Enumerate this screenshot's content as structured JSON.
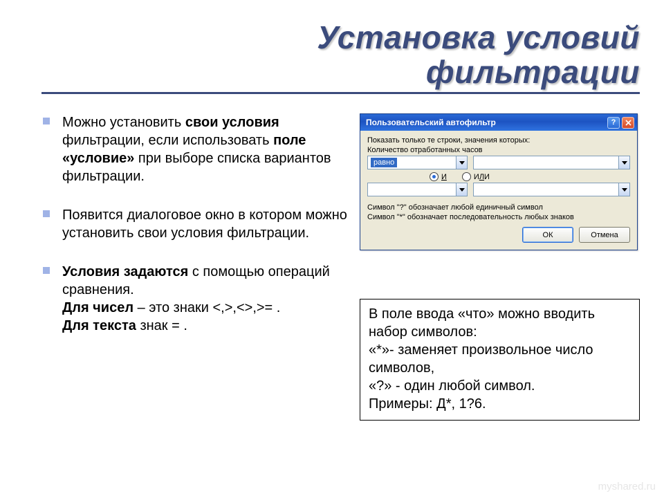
{
  "title_line1": "Установка условий",
  "title_line2": "фильтрации",
  "bullets": {
    "b1a": "Можно установить ",
    "b1b": "свои условия",
    "b1c": " фильтрации, если использовать ",
    "b1d": "поле «условие»",
    "b1e": " при выборе списка вариантов фильтрации.",
    "b2": "Появится диалоговое окно в котором можно установить свои условия фильтрации.",
    "b3a": "Условия задаются",
    "b3b": " с помощью операций сравнения.",
    "b3c": "Для чисел",
    "b3d": " – это знаки <,>,<>,>= .",
    "b3e": "Для текста",
    "b3f": "  знак = ."
  },
  "dialog": {
    "title": "Пользовательский автофильтр",
    "show_label": "Показать только те строки, значения которых:",
    "field_label": "Количество отработанных часов",
    "op_value": "равно",
    "radio_and": "И",
    "radio_or": "ИЛИ",
    "note1": "Символ \"?\" обозначает любой единичный символ",
    "note2": "Символ \"*\" обозначает последовательность любых знаков",
    "ok": "ОК",
    "cancel": "Отмена"
  },
  "caption": {
    "l1": "В поле ввода «что» можно вводить набор символов:",
    "l2": "«*»- заменяет произвольное число символов,",
    "l3": "«?» - один любой символ.",
    "l4": "Примеры: Д*, 1?6."
  },
  "watermark": "myshared.ru"
}
